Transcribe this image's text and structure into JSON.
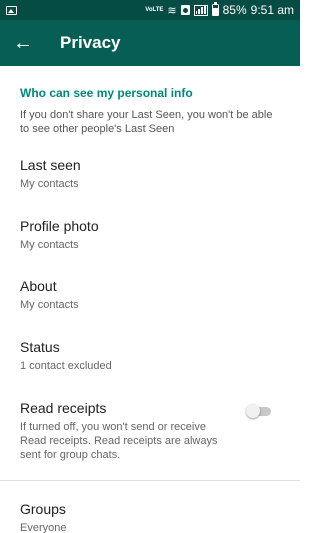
{
  "status_bar": {
    "volte_label": "VoLTE",
    "battery": "85%",
    "time": "9:51 am",
    "icons": [
      "image-icon",
      "volte-icon",
      "wifi-icon",
      "sim-icon",
      "signal-icon",
      "battery-icon"
    ]
  },
  "app_bar": {
    "back_icon": "←",
    "title": "Privacy",
    "color": "#075e54"
  },
  "section": {
    "header": "Who can see my personal info",
    "description": "If you don't share your Last Seen, you won't be able to see other people's Last Seen",
    "accent": "#00897b"
  },
  "items": [
    {
      "title": "Last seen",
      "subtitle": "My contacts"
    },
    {
      "title": "Profile photo",
      "subtitle": "My contacts"
    },
    {
      "title": "About",
      "subtitle": "My contacts"
    },
    {
      "title": "Status",
      "subtitle": "1 contact excluded"
    },
    {
      "title": "Read receipts",
      "subtitle": "If turned off, you won't send or receive Read receipts. Read receipts are always sent for group chats.",
      "toggle_on": false
    },
    {
      "title": "Groups",
      "subtitle": "Everyone"
    }
  ]
}
